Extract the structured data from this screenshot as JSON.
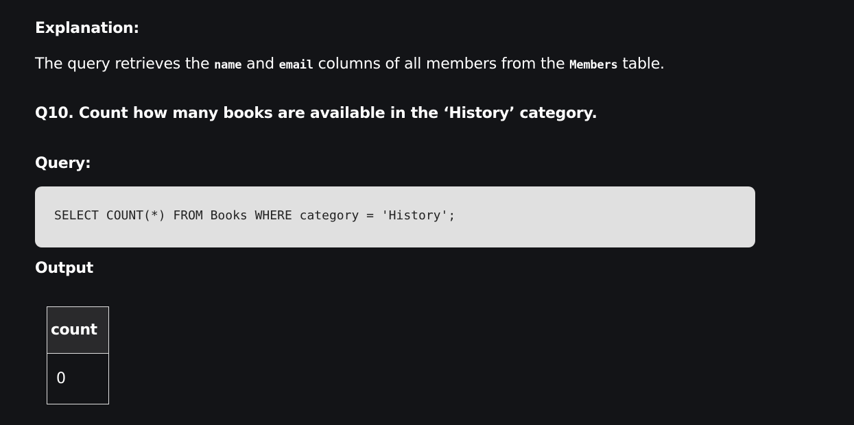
{
  "explanation": {
    "heading": "Explanation:",
    "text_before": "The query retrieves the ",
    "code1": "name",
    "text_mid1": " and ",
    "code2": "email",
    "text_mid2": " columns of all members from the ",
    "code3": "Members",
    "text_after": " table."
  },
  "question": {
    "heading": "Q10. Count how many books are available in the ‘History’ category."
  },
  "query": {
    "heading": "Query:",
    "code": "SELECT COUNT(*) FROM Books WHERE category = 'History';"
  },
  "output": {
    "heading": "Output",
    "table": {
      "headers": [
        "count"
      ],
      "rows": [
        [
          "0"
        ]
      ]
    }
  }
}
